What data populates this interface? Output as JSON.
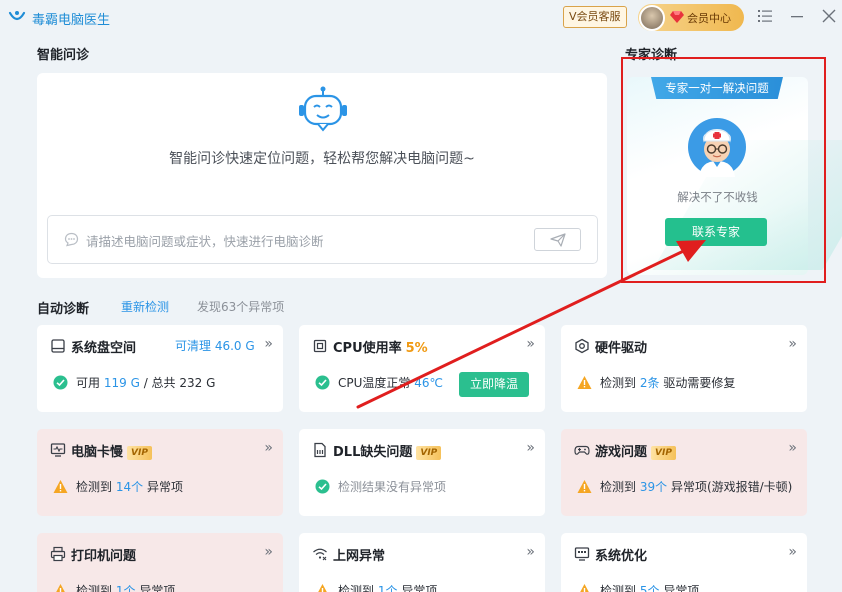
{
  "app": {
    "title": "毒霸电脑医生"
  },
  "header": {
    "vip_service": "V会员客服",
    "member_center": "会员中心"
  },
  "smart": {
    "section_title": "智能问诊",
    "description": "智能问诊快速定位问题，轻松帮您解决电脑问题~",
    "placeholder": "请描述电脑问题或症状，快速进行电脑诊断"
  },
  "expert": {
    "section_title": "专家诊断",
    "ribbon": "专家一对一解决问题",
    "note": "解决不了不收钱",
    "contact_button": "联系专家"
  },
  "auto": {
    "section_title": "自动诊断",
    "recheck": "重新检测",
    "found": "发现63个异常项"
  },
  "tiles": {
    "disk": {
      "title": "系统盘空间",
      "cleanable_label": "可清理",
      "cleanable_value": "46.0 G",
      "available_label": "可用",
      "available_value": "119 G",
      "total_label": "/ 总共",
      "total_value": "232 G"
    },
    "cpu": {
      "title": "CPU使用率",
      "percent": "5%",
      "status": "CPU温度正常",
      "temp": "46℃",
      "button": "立即降温"
    },
    "driver": {
      "title": "硬件驱动",
      "prefix": "检测到",
      "count": "2条",
      "suffix": "驱动需要修复"
    },
    "lag": {
      "title": "电脑卡慢",
      "vip": "VIP",
      "prefix": "检测到",
      "count": "14个",
      "suffix": "异常项"
    },
    "dll": {
      "title": "DLL缺失问题",
      "vip": "VIP",
      "status": "检测结果没有异常项"
    },
    "game": {
      "title": "游戏问题",
      "vip": "VIP",
      "prefix": "检测到",
      "count": "39个",
      "suffix": "异常项(游戏报错/卡顿)"
    },
    "printer": {
      "title": "打印机问题",
      "prefix": "检测到",
      "count": "1个",
      "suffix": "异常项"
    },
    "network": {
      "title": "上网异常",
      "prefix": "检测到",
      "count": "1个",
      "suffix": "异常项"
    },
    "optimize": {
      "title": "系统优化",
      "prefix": "检测到",
      "count": "5个",
      "suffix": "异常项"
    }
  }
}
